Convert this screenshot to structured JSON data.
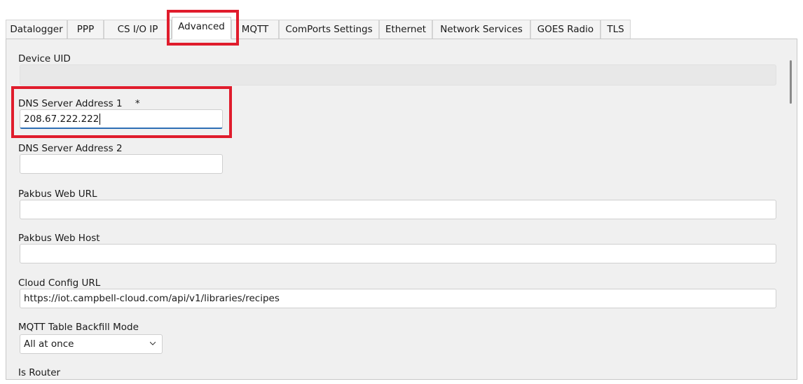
{
  "tabs": [
    {
      "label": "Datalogger"
    },
    {
      "label": "PPP"
    },
    {
      "label": "CS I/O IP"
    },
    {
      "label": "Advanced",
      "active": true
    },
    {
      "label": "MQTT"
    },
    {
      "label": "ComPorts Settings"
    },
    {
      "label": "Ethernet"
    },
    {
      "label": "Network Services"
    },
    {
      "label": "GOES Radio"
    },
    {
      "label": "TLS"
    }
  ],
  "form": {
    "device_uid": {
      "label": "Device UID",
      "value": ""
    },
    "dns1": {
      "label": "DNS Server Address 1",
      "required_mark": "*",
      "value": "208.67.222.222"
    },
    "dns2": {
      "label": "DNS Server Address 2",
      "value": ""
    },
    "pakbus_web_url": {
      "label": "Pakbus Web URL",
      "value": ""
    },
    "pakbus_web_host": {
      "label": "Pakbus Web Host",
      "value": ""
    },
    "cloud_config_url": {
      "label": "Cloud Config URL",
      "value": "https://iot.campbell-cloud.com/api/v1/libraries/recipes"
    },
    "mqtt_backfill": {
      "label": "MQTT Table Backfill Mode",
      "value": "All at once"
    },
    "is_router": {
      "label": "Is Router"
    }
  },
  "colors": {
    "highlight": "#e01c2c",
    "focus_underline": "#2d6fb5"
  },
  "icons": {
    "dropdown": "chevron-down-icon"
  }
}
